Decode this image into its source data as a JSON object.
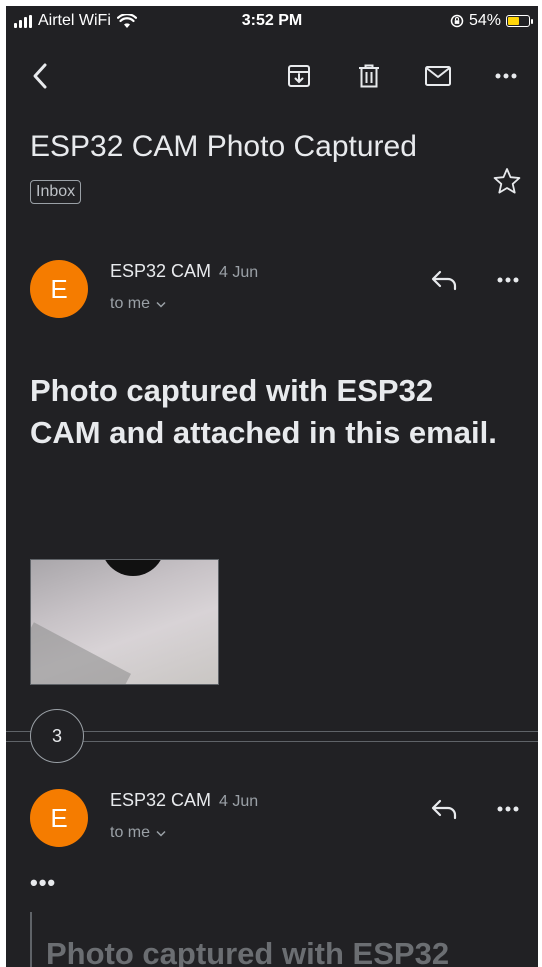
{
  "status_bar": {
    "carrier": "Airtel WiFi",
    "time": "3:52 PM",
    "battery": "54%",
    "battery_level": 0.54,
    "battery_color": "#ffd60a"
  },
  "toolbar": {
    "icons": [
      "back-icon",
      "archive-icon",
      "delete-icon",
      "mark-unread-icon",
      "more-icon"
    ]
  },
  "email": {
    "subject": "ESP32 CAM Photo Captured",
    "label": "Inbox",
    "avatar_color": "#f57c00"
  },
  "messages": [
    {
      "avatar_letter": "E",
      "sender": "ESP32 CAM",
      "date": "4 Jun",
      "recipient": "to me",
      "body": "Photo captured with ESP32 CAM and attached in this email."
    },
    {
      "avatar_letter": "E",
      "sender": "ESP32 CAM",
      "date": "4 Jun",
      "recipient": "to me",
      "trimmed_indicator": "•••",
      "quoted_preview": "Photo captured with ESP32"
    }
  ],
  "collapsed_count": "3"
}
